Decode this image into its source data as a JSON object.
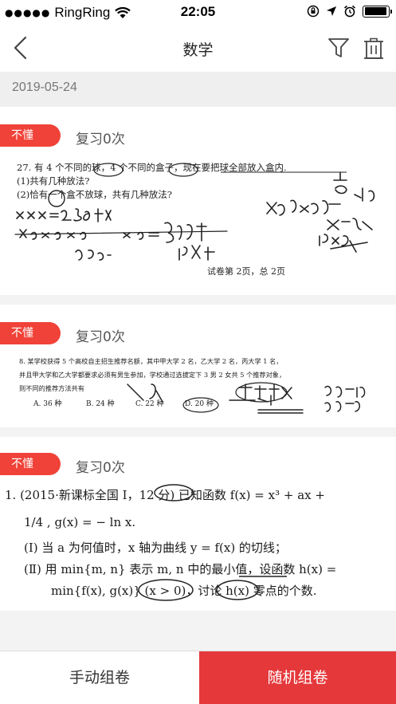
{
  "status_bar": {
    "dots": "●●●●●",
    "carrier": "RingRing",
    "time": "22:05",
    "battery_level": 0.95
  },
  "nav": {
    "title": "数学"
  },
  "date": "2019-05-24",
  "colors": {
    "accent": "#e5383b",
    "badge": "#f04238"
  },
  "cards": [
    {
      "badge": "不懂",
      "review": "复习0次",
      "question": {
        "line1": "27. 有 4 个不同的球，4 个不同的盒子，现在要把球全部放入盒内.",
        "line2": "(1)共有几种放法?",
        "line3": "(2)恰有一个盒不放球，共有几种放法?",
        "footer": "试卷第 2页，总 2页"
      }
    },
    {
      "badge": "不懂",
      "review": "复习0次",
      "question": {
        "line1": "8. 某学校获得 5 个高校自主招生推荐名额，其中甲大学 2 名，乙大学 2 名，丙大学 1 名，",
        "line2": "并且甲大学和乙大学都要求必须有男生参加，学校通过选拔定下 3 男 2 女共 5 个推荐对象，",
        "line3": "则不同的推荐方法共有",
        "options": [
          "A. 36 种",
          "B. 24 种",
          "C. 22 种",
          "D. 20 种"
        ]
      }
    },
    {
      "badge": "不懂",
      "review": "复习0次",
      "question": {
        "line1": "1. (2015·新课标全国 Ⅰ，12 分) 已知函数 f(x) = x³ + ax +",
        "line2": "1/4 , g(x) = − ln x.",
        "line3": "(Ⅰ) 当 a 为何值时，x 轴为曲线 y = f(x) 的切线；",
        "line4": "(Ⅱ) 用 min{m, n} 表示 m, n 中的最小值，设函数 h(x) =",
        "line5": "min{f(x), g(x)} (x > 0)，讨论 h(x) 零点的个数."
      }
    }
  ],
  "bottom": {
    "manual": "手动组卷",
    "random": "随机组卷"
  }
}
